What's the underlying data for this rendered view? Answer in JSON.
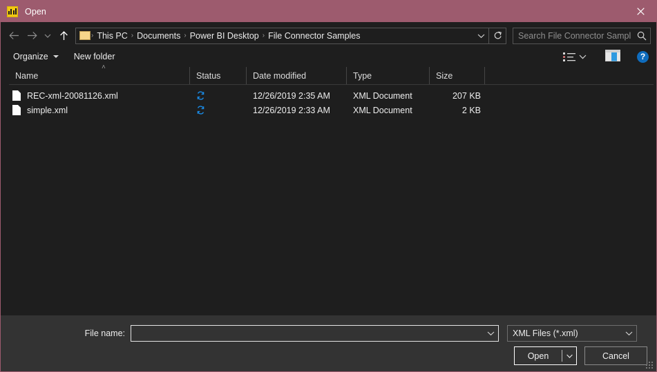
{
  "titlebar": {
    "title": "Open",
    "app_icon": "powerbi-chart-icon",
    "close_label": "✕",
    "bg_color": "#9d5b6e"
  },
  "nav": {
    "back_icon": "arrow-left-icon",
    "forward_icon": "arrow-right-icon",
    "recent_icon": "chevron-down-icon",
    "up_icon": "arrow-up-icon",
    "address": {
      "folder_icon": "folder-icon",
      "crumbs": [
        "This PC",
        "Documents",
        "Power BI Desktop",
        "File Connector Samples"
      ],
      "separator": "›",
      "dropdown_icon": "chevron-down-icon",
      "refresh_icon": "refresh-icon"
    },
    "search": {
      "placeholder": "Search File Connector Samples",
      "value": "",
      "icon": "search-icon"
    }
  },
  "toolbar": {
    "organize_label": "Organize",
    "new_folder_label": "New folder",
    "view_icon": "list-view-icon",
    "view_caret_icon": "chevron-down-icon",
    "preview_pane_icon": "preview-pane-icon",
    "help_icon": "help-icon",
    "help_label": "?"
  },
  "columns": {
    "sort_indicator": "˄",
    "headers": [
      "Name",
      "Status",
      "Date modified",
      "Type",
      "Size"
    ]
  },
  "files": [
    {
      "icon": "xml-document-icon",
      "name": "REC-xml-20081126.xml",
      "status_icon": "onedrive-sync-icon",
      "date_modified": "12/26/2019 2:35 AM",
      "type": "XML Document",
      "size": "207 KB"
    },
    {
      "icon": "xml-document-icon",
      "name": "simple.xml",
      "status_icon": "onedrive-sync-icon",
      "date_modified": "12/26/2019 2:33 AM",
      "type": "XML Document",
      "size": "2 KB"
    }
  ],
  "footer": {
    "file_name_label": "File name:",
    "file_name_value": "",
    "file_name_placeholder": "",
    "file_name_chevron": "chevron-down-icon",
    "filter_value": "XML Files (*.xml)",
    "filter_chevron": "chevron-down-icon",
    "open_label": "Open",
    "open_caret_icon": "chevron-down-icon",
    "cancel_label": "Cancel",
    "resize_grip": "resize-grip-icon"
  }
}
